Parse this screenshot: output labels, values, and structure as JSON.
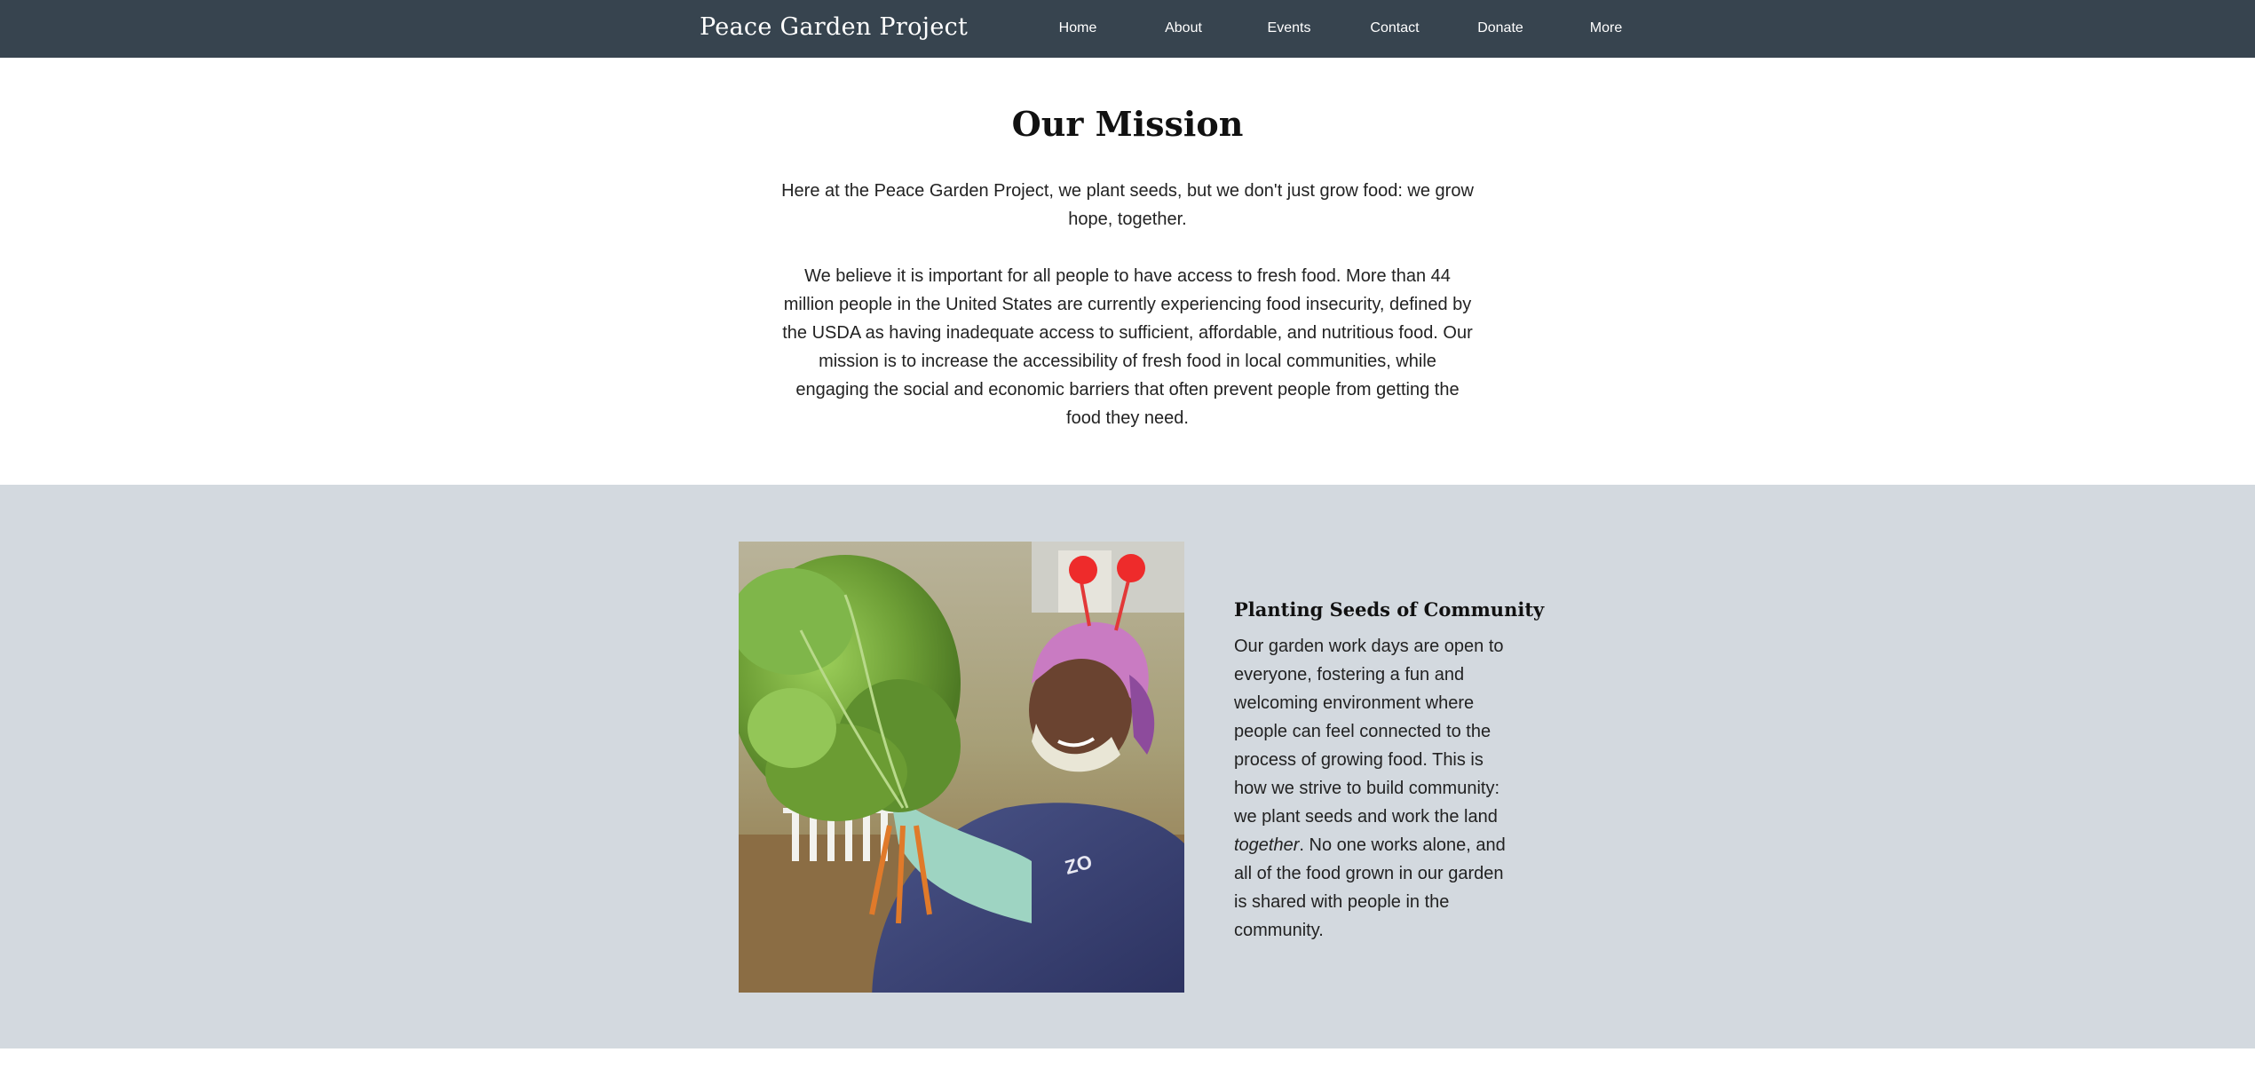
{
  "header": {
    "brand": "Peace Garden Project",
    "background_color": "#37444f",
    "nav": [
      "Home",
      "About",
      "Events",
      "Contact",
      "Donate",
      "More"
    ]
  },
  "mission": {
    "title": "Our Mission",
    "intro": "Here at the Peace Garden Project, we plant seeds, but we don't just grow food: we grow hope, together.",
    "body": "We believe it is important for all people to have access to fresh food. More than 44 million people in the United States are currently experiencing food insecurity, defined by the USDA as having inadequate access to sufficient, affordable, and nutritious food. Our mission is to increase the accessibility of fresh food in local communities, while engaging the social and economic barriers that often prevent people from getting the food they need."
  },
  "community": {
    "background_color": "#d3d9df",
    "title": "Planting Seeds of Community",
    "body_before": "Our garden work days are open to everyone, fostering a fun and welcoming environment where people can feel connected to the process of growing food. This is how we strive to build community: we plant seeds and work the land ",
    "body_emphasis": "together",
    "body_after": ". No one works alone, and all of the food grown in our garden is shared with people in the community."
  }
}
